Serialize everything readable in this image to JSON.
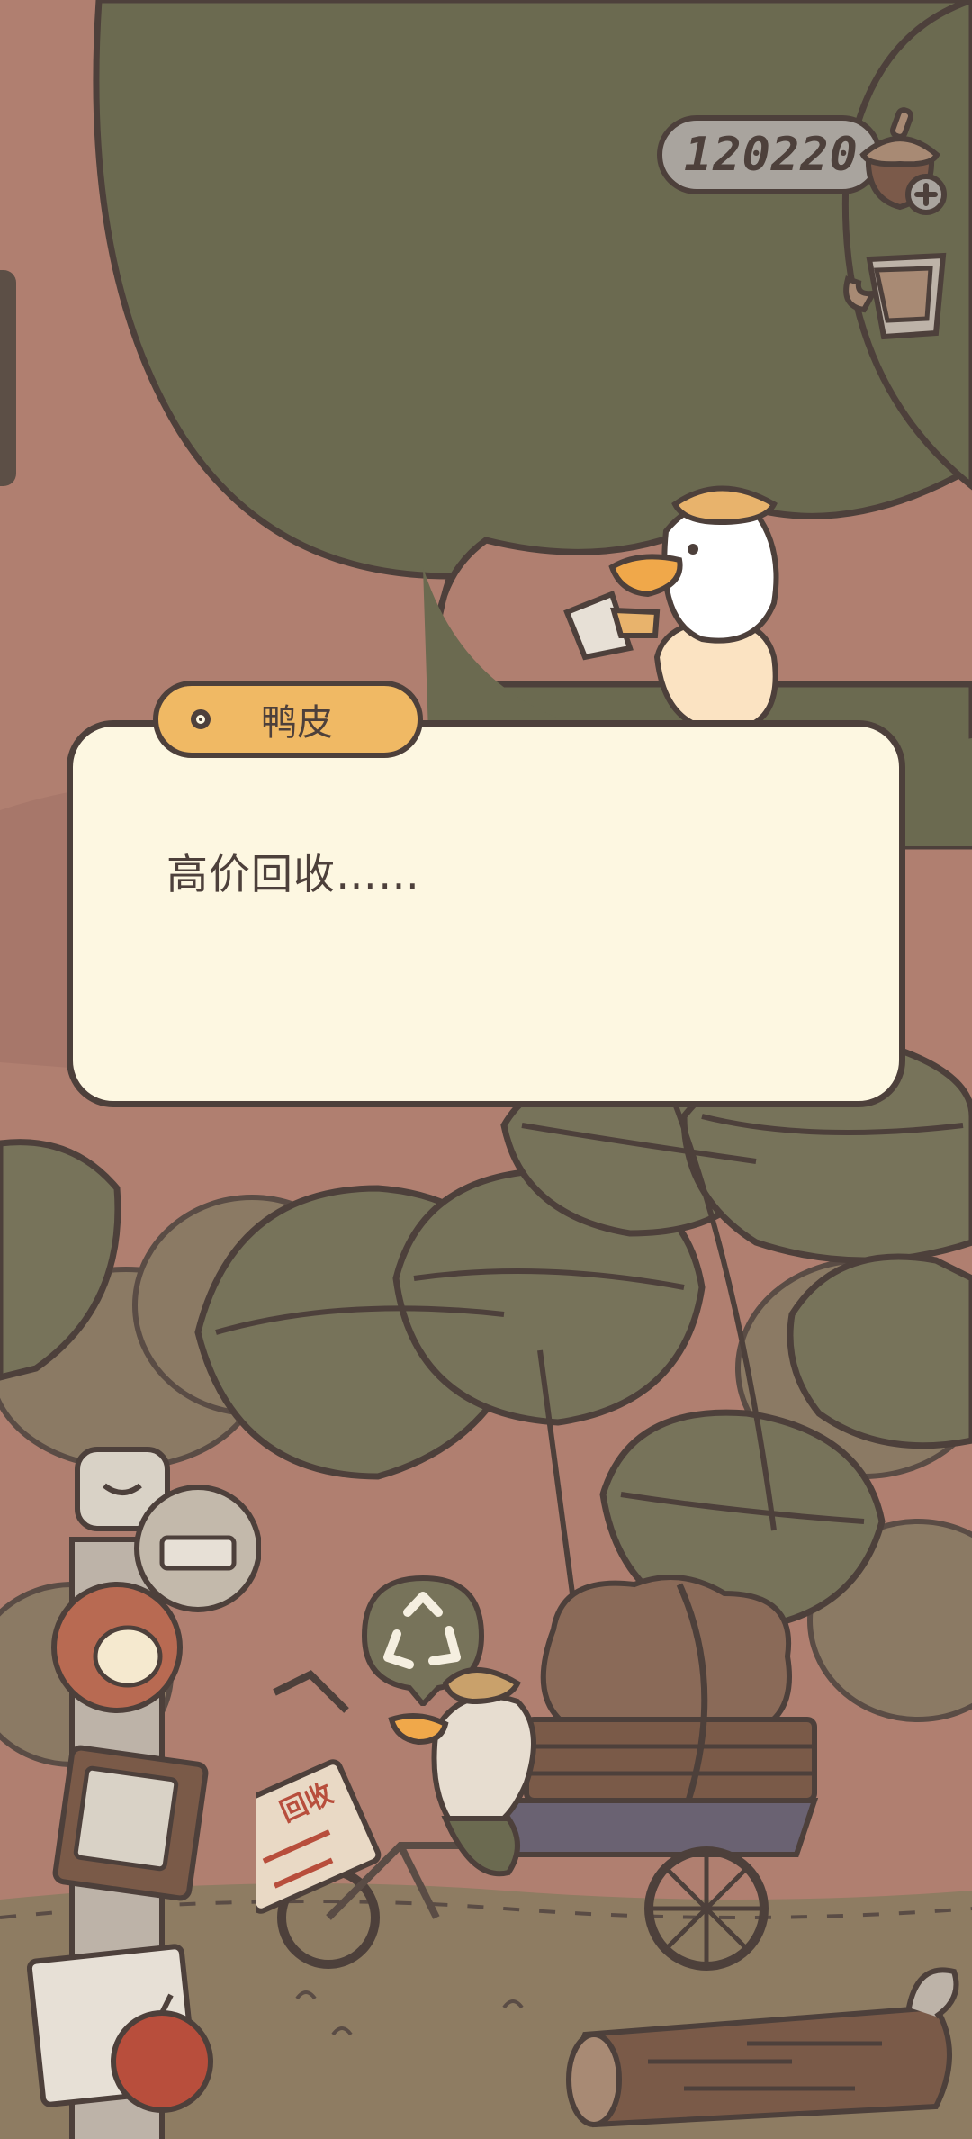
{
  "hud": {
    "currency_value": "120220",
    "currency_icon": "acorn-icon",
    "add_icon": "plus-icon",
    "mug_icon": "mug-icon"
  },
  "dialogue": {
    "speaker": "鸭皮",
    "text": "高价回收……"
  },
  "scene": {
    "cart_sign": "回收",
    "recycle_icon": "recycle-icon"
  },
  "colors": {
    "sky": "#b07f70",
    "tree_canopy": "#6b6a50",
    "outline": "#4d403b",
    "dialog_bg": "#fdf7e1",
    "name_tag": "#f0b964",
    "ground": "#8e7c62"
  }
}
